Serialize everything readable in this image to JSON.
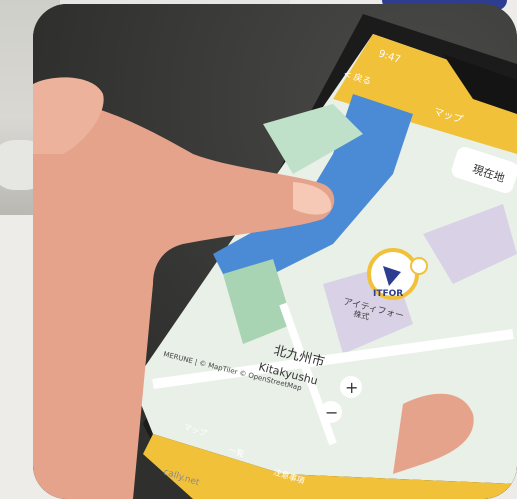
{
  "image": {
    "description_tags": [
      "photo",
      "smartphone",
      "map-app",
      "finger"
    ],
    "accent_color": "#f2c13a"
  },
  "phone": {
    "status_time": "9:47",
    "back_label": "< 戻る",
    "screen_title": "マップ",
    "locate_button": "現在地",
    "place_label_ja": "アイティフォー",
    "place_label_ja_2": "株式",
    "city_label_ja": "北九州市",
    "city_label_en": "Kitakyushu",
    "map_attribution": "MERUNE | © MapTiler © OpenStreetMap",
    "zoom_in": "+",
    "zoom_out": "−",
    "tab_map_label": "マップ",
    "tab_list_label": "一覧",
    "tab_info_label": "注意事項",
    "bottom_url": "cally.net",
    "logo_text": "ITFOR"
  }
}
